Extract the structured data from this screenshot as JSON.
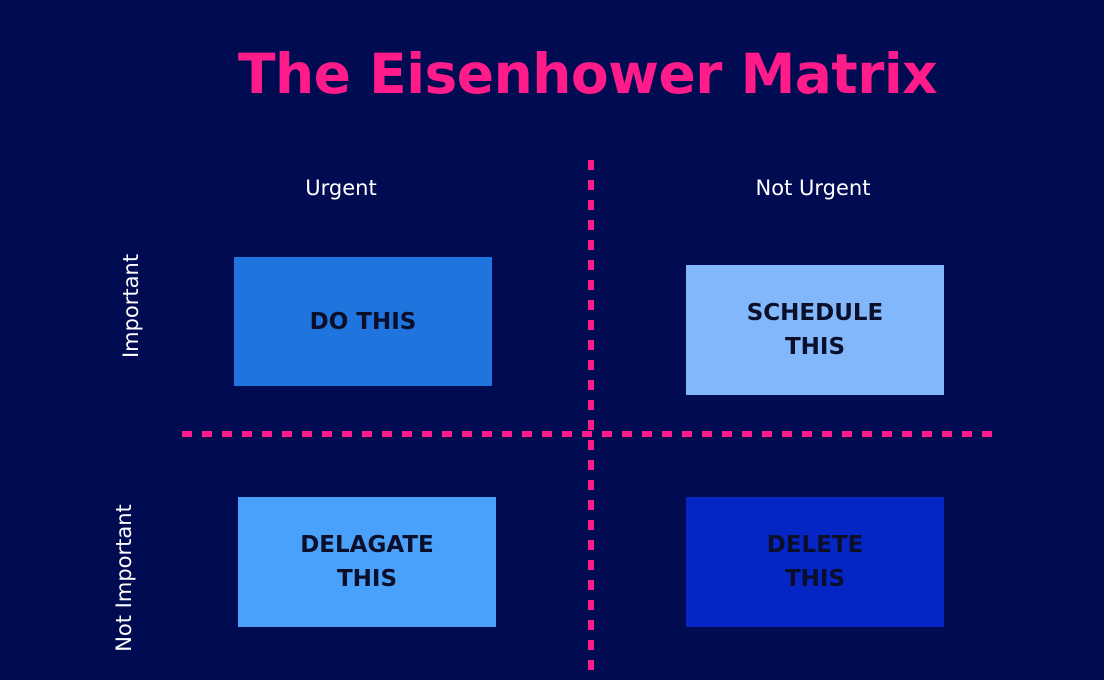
{
  "title": "The Eisenhower Matrix",
  "columns": {
    "urgent": "Urgent",
    "not_urgent": "Not Urgent"
  },
  "rows": {
    "important": "Important",
    "not_important": "Not Important"
  },
  "quadrants": {
    "do": "DO  THIS",
    "schedule": "SCHEDULE\nTHIS",
    "delegate": "DELAGATE\nTHIS",
    "delete": "DELETE\nTHIS"
  },
  "colors": {
    "background": "#000b52",
    "accent": "#ff1c8a",
    "do_box": "#1f74dd",
    "schedule_box": "#82b8fb",
    "delegate_box": "#4aa1fb",
    "delete_box": "#0525c4",
    "box_text": "#0b0f2a"
  }
}
